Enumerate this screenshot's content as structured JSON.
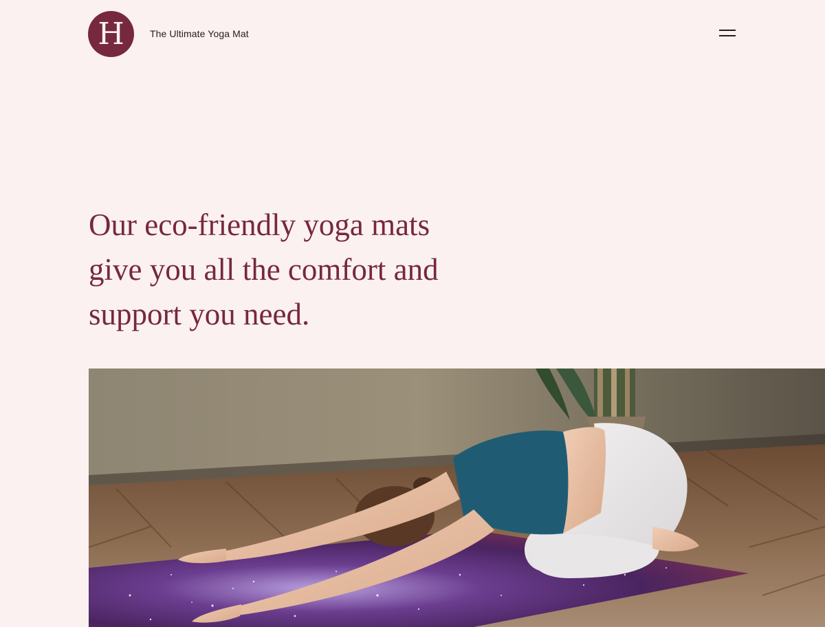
{
  "header": {
    "logo_letter": "H",
    "site_title": "The Ultimate Yoga Mat",
    "menu_icon": "hamburger-menu-icon"
  },
  "hero": {
    "heading_line1": "Our eco-friendly yoga mats",
    "heading_line2": "give you all the comfort and",
    "heading_line3": "support you need.",
    "image_alt": "Woman in child's pose on a purple galaxy-print yoga mat"
  },
  "colors": {
    "background": "#fbf1f0",
    "accent": "#76283f",
    "text": "#2a1a1f"
  }
}
